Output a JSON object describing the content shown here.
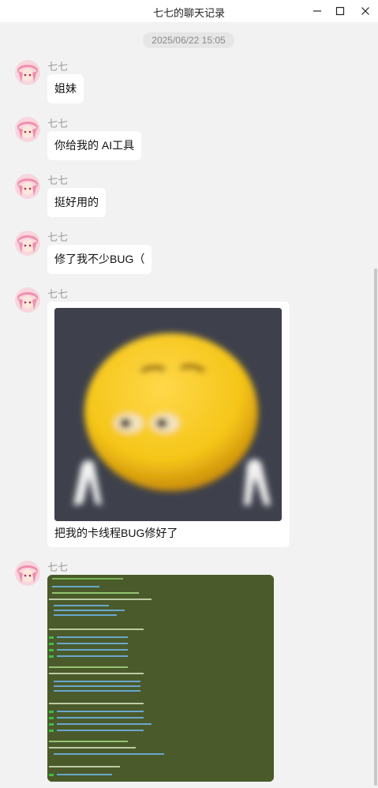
{
  "window": {
    "title": "七七的聊天记录"
  },
  "chat": {
    "date": "2025/06/22 15:05",
    "sender": "七七",
    "messages": [
      {
        "text": "姐妹"
      },
      {
        "text": "你给我的 AI工具"
      },
      {
        "text": "挺好用的"
      },
      {
        "text": "修了我不少BUG（"
      },
      {
        "caption": "把我的卡线程BUG修好了"
      }
    ]
  },
  "colors": {
    "background": "#f2f2f2",
    "bubble": "#ffffff",
    "sender": "#999999",
    "terminal": "#4a5a2a",
    "sticker_face": "#f5c518"
  },
  "icons": {
    "minimize": "minimize-icon",
    "maximize": "maximize-icon",
    "close": "close-icon"
  }
}
